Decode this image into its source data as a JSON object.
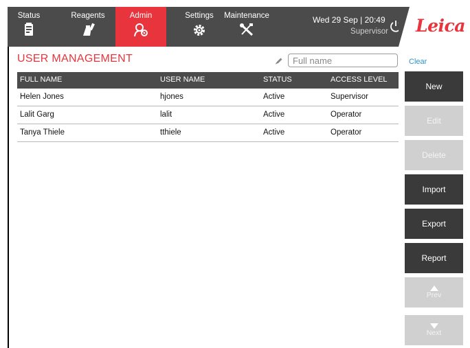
{
  "nav": {
    "items": [
      {
        "label": "Status",
        "icon": "status-icon"
      },
      {
        "label": "Reagents",
        "icon": "reagents-icon"
      },
      {
        "label": "Admin",
        "icon": "admin-icon",
        "active": true
      },
      {
        "label": "Settings",
        "icon": "settings-icon"
      },
      {
        "label": "Maintenance",
        "icon": "maintenance-icon"
      }
    ],
    "datetime": "Wed 29 Sep | 20:49",
    "user_role": "Supervisor",
    "logo": "Leica",
    "accent_color": "#e8343c",
    "bar_color": "#4b4b4b"
  },
  "page": {
    "title": "USER MANAGEMENT",
    "filter_placeholder": "Full name",
    "filter_value": "",
    "clear_label": "Clear"
  },
  "table": {
    "columns": [
      "FULL NAME",
      "USER NAME",
      "STATUS",
      "ACCESS LEVEL"
    ],
    "rows": [
      [
        "Helen Jones",
        "hjones",
        "Active",
        "Supervisor"
      ],
      [
        "Lalit Garg",
        "lalit",
        "Active",
        "Operator"
      ],
      [
        "Tanya Thiele",
        "tthiele",
        "Active",
        "Operator"
      ]
    ]
  },
  "actions": {
    "new": "New",
    "edit": "Edit",
    "delete": "Delete",
    "import": "Import",
    "export": "Export",
    "report": "Report",
    "prev": "Prev",
    "next": "Next"
  }
}
